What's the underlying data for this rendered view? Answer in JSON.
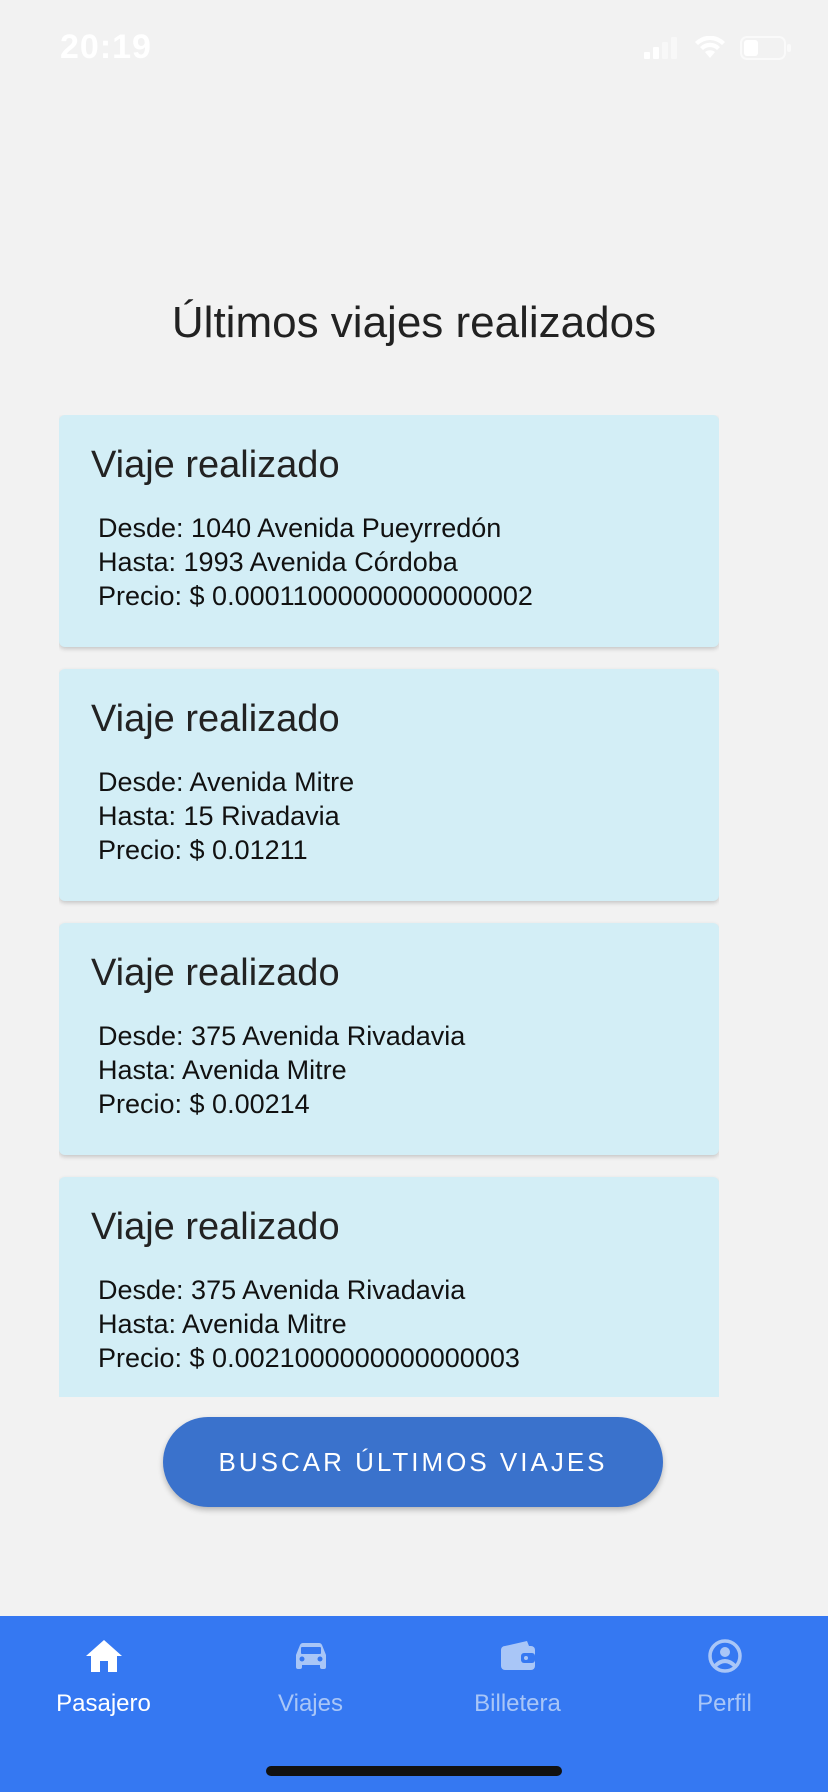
{
  "status_bar": {
    "time": "20:19"
  },
  "page": {
    "title": "Últimos viajes realizados"
  },
  "trips": [
    {
      "title": "Viaje realizado",
      "from": "Desde: 1040 Avenida Pueyrredón",
      "to": "Hasta: 1993 Avenida Córdoba",
      "price": "Precio: $ 0.00011000000000000002"
    },
    {
      "title": "Viaje realizado",
      "from": "Desde: Avenida Mitre",
      "to": "Hasta: 15 Rivadavia",
      "price": "Precio: $ 0.01211"
    },
    {
      "title": "Viaje realizado",
      "from": "Desde: 375 Avenida Rivadavia",
      "to": "Hasta: Avenida Mitre",
      "price": "Precio: $ 0.00214"
    },
    {
      "title": "Viaje realizado",
      "from": "Desde: 375 Avenida Rivadavia",
      "to": "Hasta: Avenida Mitre",
      "price": "Precio: $ 0.0021000000000000003"
    }
  ],
  "search_button": {
    "label": "BUSCAR ÚLTIMOS VIAJES"
  },
  "bottom_nav": {
    "items": [
      {
        "label": "Pasajero",
        "icon": "home-icon",
        "active": true
      },
      {
        "label": "Viajes",
        "icon": "car-icon",
        "active": false
      },
      {
        "label": "Billetera",
        "icon": "wallet-icon",
        "active": false
      },
      {
        "label": "Perfil",
        "icon": "account-circle-icon",
        "active": false
      }
    ]
  },
  "colors": {
    "background": "#f2f2f2",
    "card": "#d3eef6",
    "button": "#3a72cc",
    "nav": "#3578f2",
    "nav_active": "#ffffff",
    "nav_inactive": "#a9c6f7"
  }
}
